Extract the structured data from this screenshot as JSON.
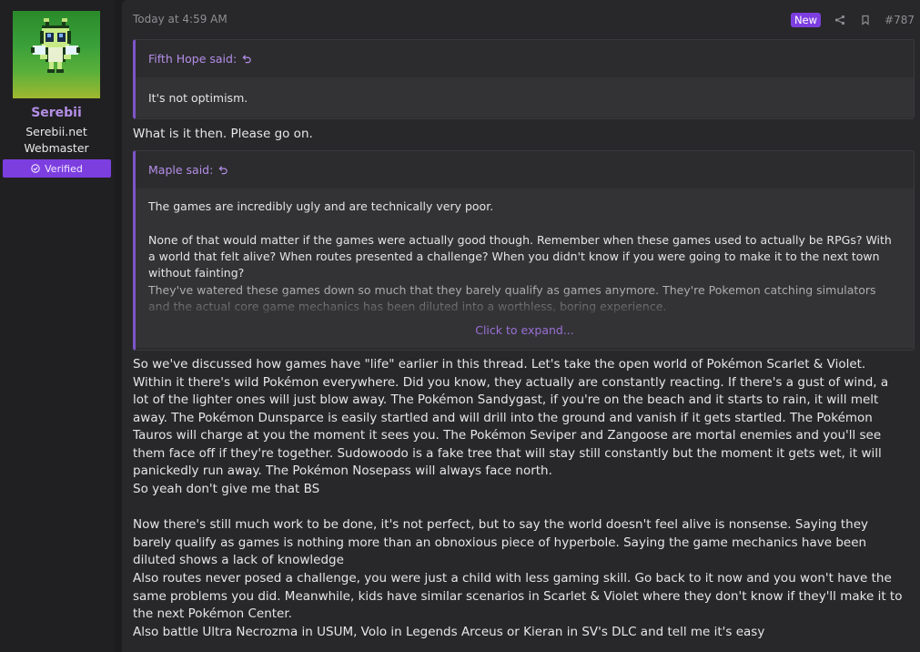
{
  "user": {
    "name": "Serebii",
    "title_line1": "Serebii.net",
    "title_line2": "Webmaster",
    "verified_label": "Verified",
    "avatar_icon": "celebi-sprite-avatar"
  },
  "post": {
    "timestamp": "Today at 4:59 AM",
    "new_badge": "New",
    "post_number": "#787",
    "quotes": [
      {
        "author": "Fifth Hope said:",
        "paragraphs": [
          "It's not optimism."
        ]
      },
      {
        "author": "Maple said:",
        "paragraphs": [
          "The games are incredibly ugly and are technically very poor.",
          "None of that would matter if the games were actually good though. Remember when these games used to actually be RPGs? With a world that felt alive? When routes presented a challenge? When you didn't know if you were going to make it to the next town without fainting?",
          "They've watered these games down so much that they barely qualify as games anymore. They're Pokemon catching simulators and the actual core game mechanics has been diluted into a worthless, boring experience."
        ],
        "expand_label": "Click to expand..."
      }
    ],
    "reply_1": "What is it then. Please go on.",
    "reply_2": "So we've discussed how games have \"life\" earlier in this thread. Let's take the open world of Pokémon Scarlet & Violet. Within it there's wild Pokémon everywhere. Did you know, they actually are constantly reacting. If there's a gust of wind, a lot of the lighter ones will just blow away. The Pokémon Sandygast, if you're on the beach and it starts to rain, it will melt away. The Pokémon Dunsparce is easily startled and will drill into the ground and vanish if it gets startled. The Pokémon Tauros will charge at you the moment it sees you. The Pokémon Seviper and Zangoose are mortal enemies and you'll see them face off if they're together. Sudowoodo is a fake tree that will stay still constantly but the moment it gets wet, it will panickedly run away. The Pokémon Nosepass will always face north.",
    "reply_3": "So yeah don't give me that BS",
    "reply_4": "Now there's still much work to be done, it's not perfect, but to say the world doesn't feel alive is nonsense. Saying they barely qualify as games is nothing more than an obnoxious piece of hyperbole. Saying the game mechanics have been diluted shows a lack of knowledge",
    "reply_5": "Also routes never posed a challenge, you were just a child with less gaming skill. Go back to it now and you won't have the same problems you did. Meanwhile, kids have similar scenarios in Scarlet & Violet where they don't know if they'll make it to the next Pokémon Center.",
    "reply_6": "Also battle Ultra Necrozma in USUM, Volo in Legends Arceus or Kieran in SV's DLC and tell me it's easy"
  },
  "colors": {
    "accent": "#7d3ee0",
    "username": "#b48ee6",
    "quote_border": "#7d55c7"
  }
}
